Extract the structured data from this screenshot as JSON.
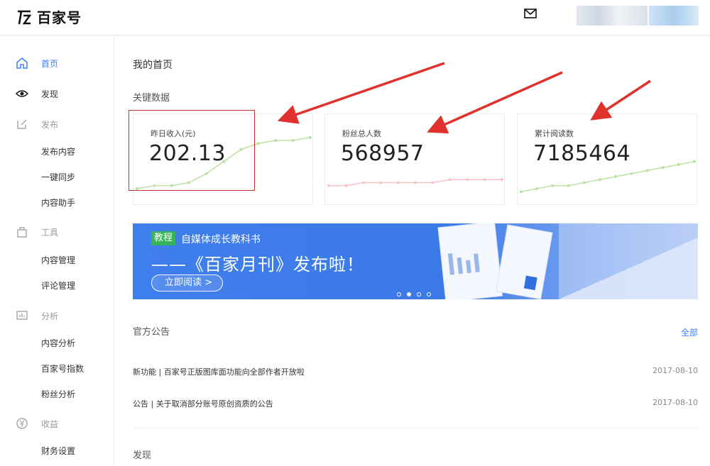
{
  "header": {
    "logo_text": "百家号",
    "mail_icon": "mail-icon"
  },
  "sidebar": {
    "items": [
      {
        "label": "首页",
        "type": "top",
        "active": true,
        "icon": "home-icon"
      },
      {
        "label": "发现",
        "type": "top",
        "active": false,
        "icon": "eye-icon"
      },
      {
        "label": "发布",
        "type": "group",
        "icon": "edit-icon"
      },
      {
        "label": "发布内容",
        "type": "sub"
      },
      {
        "label": "一键同步",
        "type": "sub"
      },
      {
        "label": "内容助手",
        "type": "sub"
      },
      {
        "label": "工具",
        "type": "group",
        "icon": "bag-icon"
      },
      {
        "label": "内容管理",
        "type": "sub"
      },
      {
        "label": "评论管理",
        "type": "sub"
      },
      {
        "label": "分析",
        "type": "group",
        "icon": "chart-icon"
      },
      {
        "label": "内容分析",
        "type": "sub"
      },
      {
        "label": "百家号指数",
        "type": "sub"
      },
      {
        "label": "粉丝分析",
        "type": "sub"
      },
      {
        "label": "收益",
        "type": "group",
        "icon": "yen-icon"
      },
      {
        "label": "财务设置",
        "type": "sub"
      }
    ]
  },
  "main": {
    "page_title": "我的首页",
    "key_data_title": "关键数据",
    "cards": [
      {
        "label": "昨日收入(元)",
        "value": "202.13",
        "line_color": "#b9e2a3",
        "trend": [
          4,
          5,
          5,
          6,
          9,
          13,
          17,
          19,
          20,
          20,
          21
        ]
      },
      {
        "label": "粉丝总人数",
        "value": "568957",
        "line_color": "#f5c3c8",
        "trend": [
          5,
          5,
          6,
          6,
          6,
          6,
          6,
          7,
          7,
          7,
          7
        ]
      },
      {
        "label": "累计阅读数",
        "value": "7185464",
        "line_color": "#b9e2a3",
        "trend": [
          3,
          4,
          5,
          5,
          6,
          7,
          8,
          9,
          10,
          11,
          12,
          13
        ]
      }
    ],
    "banner": {
      "tag": "教程",
      "subtitle": "自媒体成长教科书",
      "headline": "——《百家月刊》发布啦！",
      "button": "立即阅读 >",
      "slides": 4,
      "active_slide": 1
    },
    "notice_title": "官方公告",
    "notice_more": "全部",
    "notices": [
      {
        "text": "新功能 | 百家号正版图库面功能向全部作者开放啦",
        "date": "2017-08-10"
      },
      {
        "text": "公告 | 关于取消部分账号原创资质的公告",
        "date": "2017-08-10"
      }
    ],
    "discover_title": "发现"
  },
  "colors": {
    "accent": "#3c7eff",
    "highlight": "#c9302c",
    "arrow": "#e0312c"
  }
}
